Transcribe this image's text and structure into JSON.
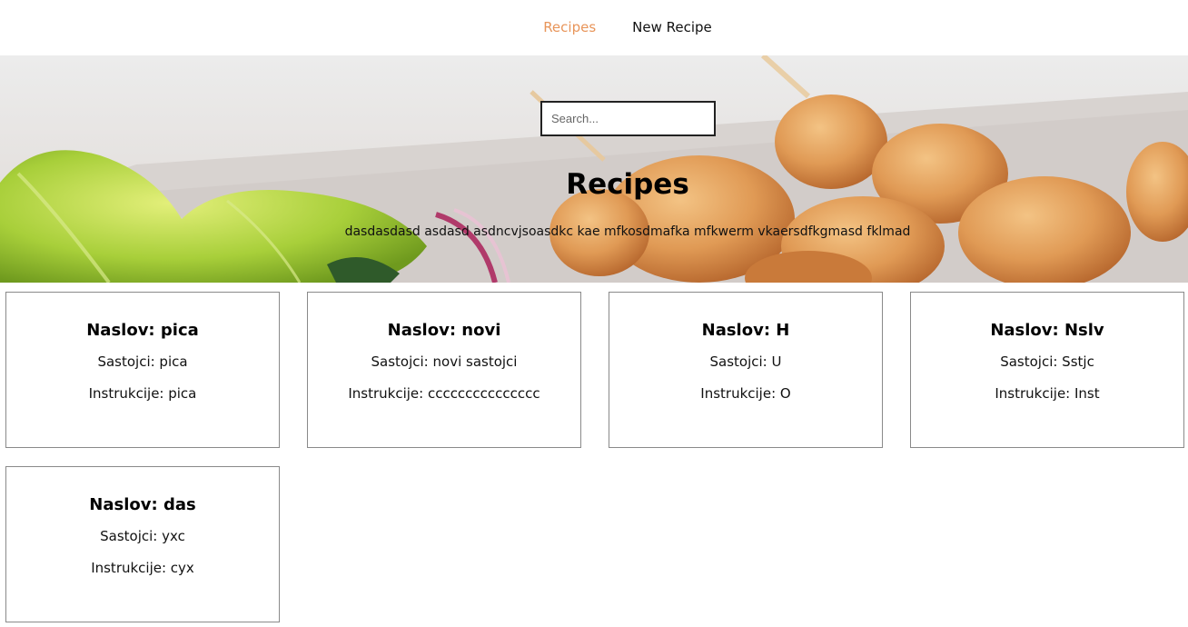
{
  "nav": {
    "items": [
      {
        "label": "Recipes",
        "active": true
      },
      {
        "label": "New Recipe",
        "active": false
      }
    ],
    "active_color": "#e8955a"
  },
  "hero": {
    "search_placeholder": "Search...",
    "title": "Recipes",
    "description": "dasdasdasd asdasd asdncvjsoasdkc kae mfkosdmafka mfkwerm vkaersdfkgmasd fklmad"
  },
  "recipes": [
    {
      "title": "Naslov: pica",
      "ingredients": "Sastojci: pica",
      "instructions": "Instrukcije: pica"
    },
    {
      "title": "Naslov: novi",
      "ingredients": "Sastojci: novi sastojci",
      "instructions": "Instrukcije: ccccccccccccccc"
    },
    {
      "title": "Naslov: H",
      "ingredients": "Sastojci: U",
      "instructions": "Instrukcije: O"
    },
    {
      "title": "Naslov: Nslv",
      "ingredients": "Sastojci: Sstjc",
      "instructions": "Instrukcije: Inst"
    },
    {
      "title": "Naslov: das",
      "ingredients": "Sastojci: yxc",
      "instructions": "Instrukcije: cyx"
    }
  ]
}
